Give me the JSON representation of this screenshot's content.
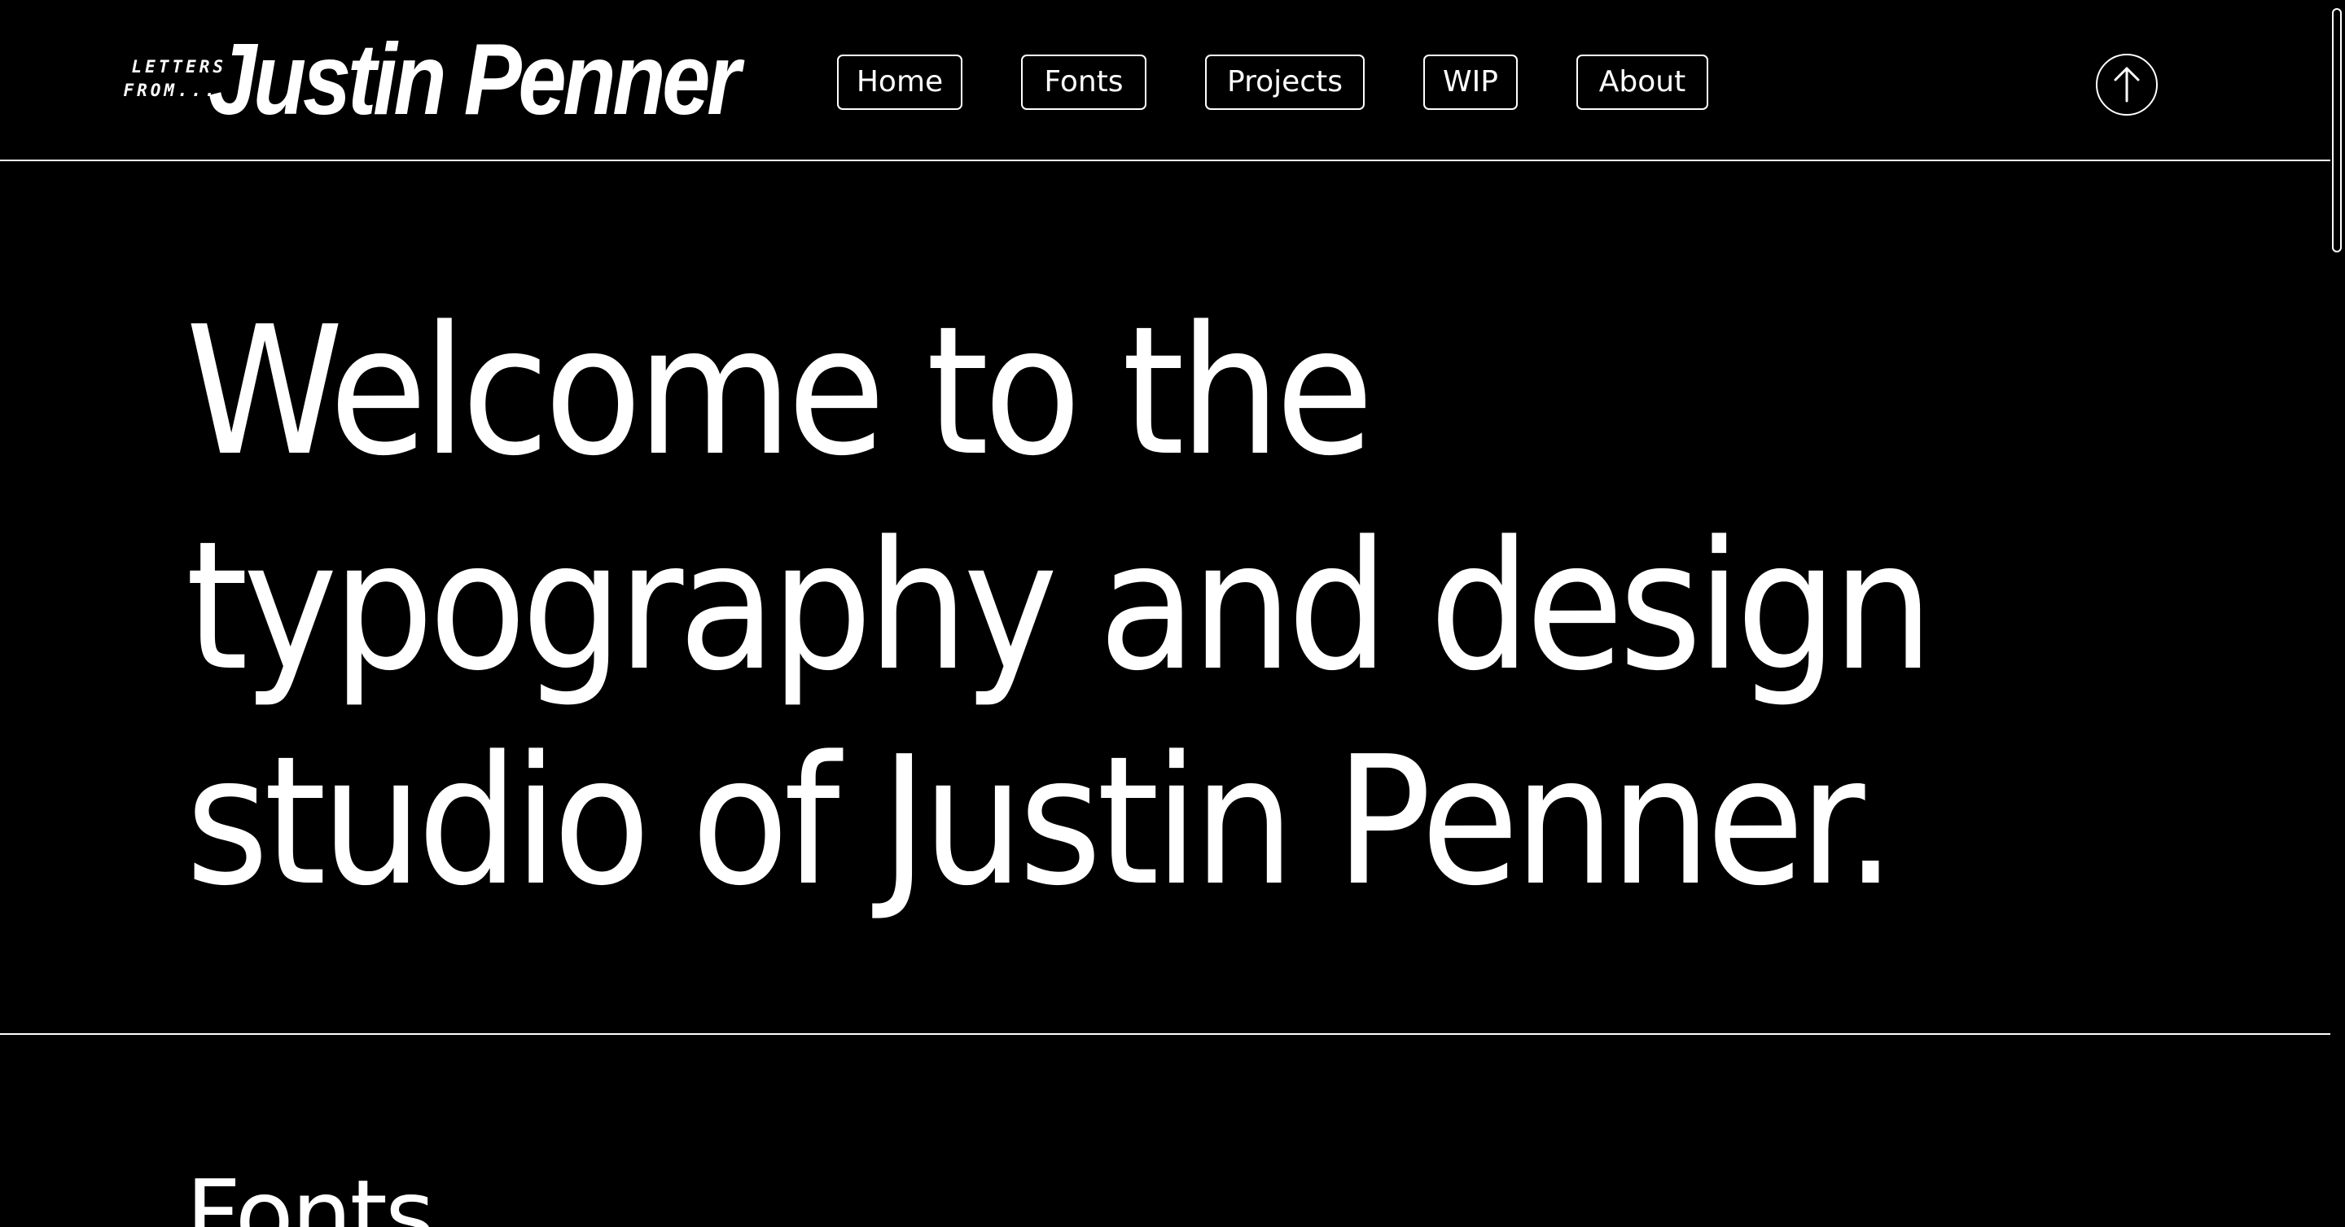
{
  "header": {
    "logo": {
      "prefix_line1": "LETTERS",
      "prefix_line2": "FROM...",
      "name": "Justin Penner"
    },
    "nav": [
      {
        "label": "Home"
      },
      {
        "label": "Fonts"
      },
      {
        "label": "Projects"
      },
      {
        "label": "WIP"
      },
      {
        "label": "About"
      }
    ],
    "up_button_icon": "arrow-up-circle-icon"
  },
  "hero": {
    "lines": [
      "Welcome to the",
      "typography and design",
      "studio of Justin Penner."
    ]
  },
  "sections": {
    "fonts_title": "Fonts"
  },
  "colors": {
    "background": "#000000",
    "foreground": "#ffffff"
  }
}
